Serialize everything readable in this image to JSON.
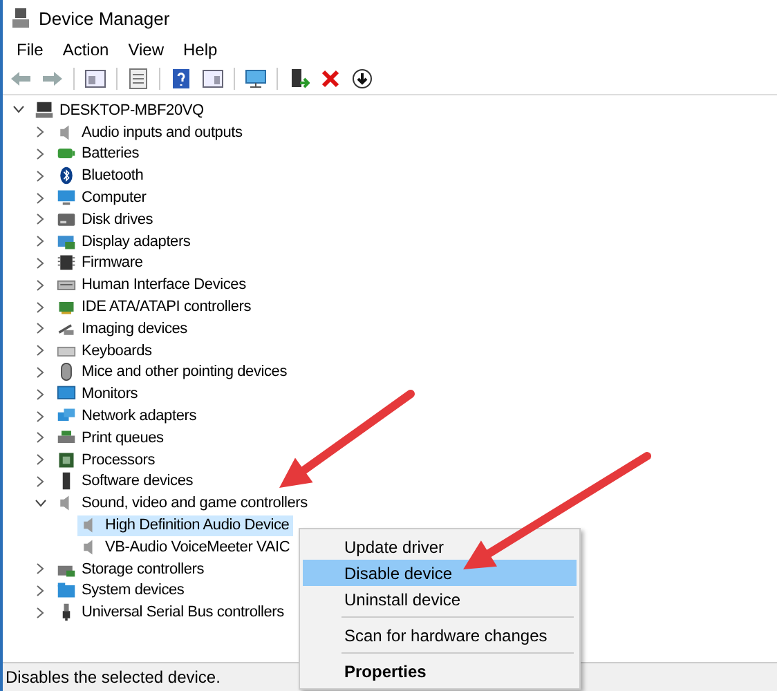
{
  "window": {
    "title": "Device Manager"
  },
  "menu_bar": [
    "File",
    "Action",
    "View",
    "Help"
  ],
  "tree": {
    "label": "DESKTOP-MBF20VQ",
    "expanded": true,
    "selected": false,
    "children": [
      {
        "label": "Audio inputs and outputs",
        "expanded": false,
        "selected": false
      },
      {
        "label": "Batteries",
        "expanded": false,
        "selected": false
      },
      {
        "label": "Bluetooth",
        "expanded": false,
        "selected": false
      },
      {
        "label": "Computer",
        "expanded": false,
        "selected": false
      },
      {
        "label": "Disk drives",
        "expanded": false,
        "selected": false
      },
      {
        "label": "Display adapters",
        "expanded": false,
        "selected": false
      },
      {
        "label": "Firmware",
        "expanded": false,
        "selected": false
      },
      {
        "label": "Human Interface Devices",
        "expanded": false,
        "selected": false
      },
      {
        "label": "IDE ATA/ATAPI controllers",
        "expanded": false,
        "selected": false
      },
      {
        "label": "Imaging devices",
        "expanded": false,
        "selected": false
      },
      {
        "label": "Keyboards",
        "expanded": false,
        "selected": false
      },
      {
        "label": "Mice and other pointing devices",
        "expanded": false,
        "selected": false
      },
      {
        "label": "Monitors",
        "expanded": false,
        "selected": false
      },
      {
        "label": "Network adapters",
        "expanded": false,
        "selected": false
      },
      {
        "label": "Print queues",
        "expanded": false,
        "selected": false
      },
      {
        "label": "Processors",
        "expanded": false,
        "selected": false
      },
      {
        "label": "Software devices",
        "expanded": false,
        "selected": false
      },
      {
        "label": "Sound, video and game controllers",
        "expanded": true,
        "selected": false,
        "children": [
          {
            "label": "High Definition Audio Device",
            "selected": true
          },
          {
            "label": "VB-Audio VoiceMeeter VAIC",
            "selected": false
          }
        ]
      },
      {
        "label": "Storage controllers",
        "expanded": false,
        "selected": false
      },
      {
        "label": "System devices",
        "expanded": false,
        "selected": false
      },
      {
        "label": "Universal Serial Bus controllers",
        "expanded": false,
        "selected": false
      }
    ]
  },
  "context_menu": [
    {
      "kind": "item",
      "label": "Update driver",
      "selected": false
    },
    {
      "kind": "item",
      "label": "Disable device",
      "selected": true
    },
    {
      "kind": "item",
      "label": "Uninstall device",
      "selected": false
    },
    {
      "kind": "separator"
    },
    {
      "kind": "item",
      "label": "Scan for hardware changes",
      "selected": false
    },
    {
      "kind": "separator"
    },
    {
      "kind": "default",
      "label": "Properties",
      "selected": false
    }
  ],
  "status_bar": "Disables the selected device."
}
